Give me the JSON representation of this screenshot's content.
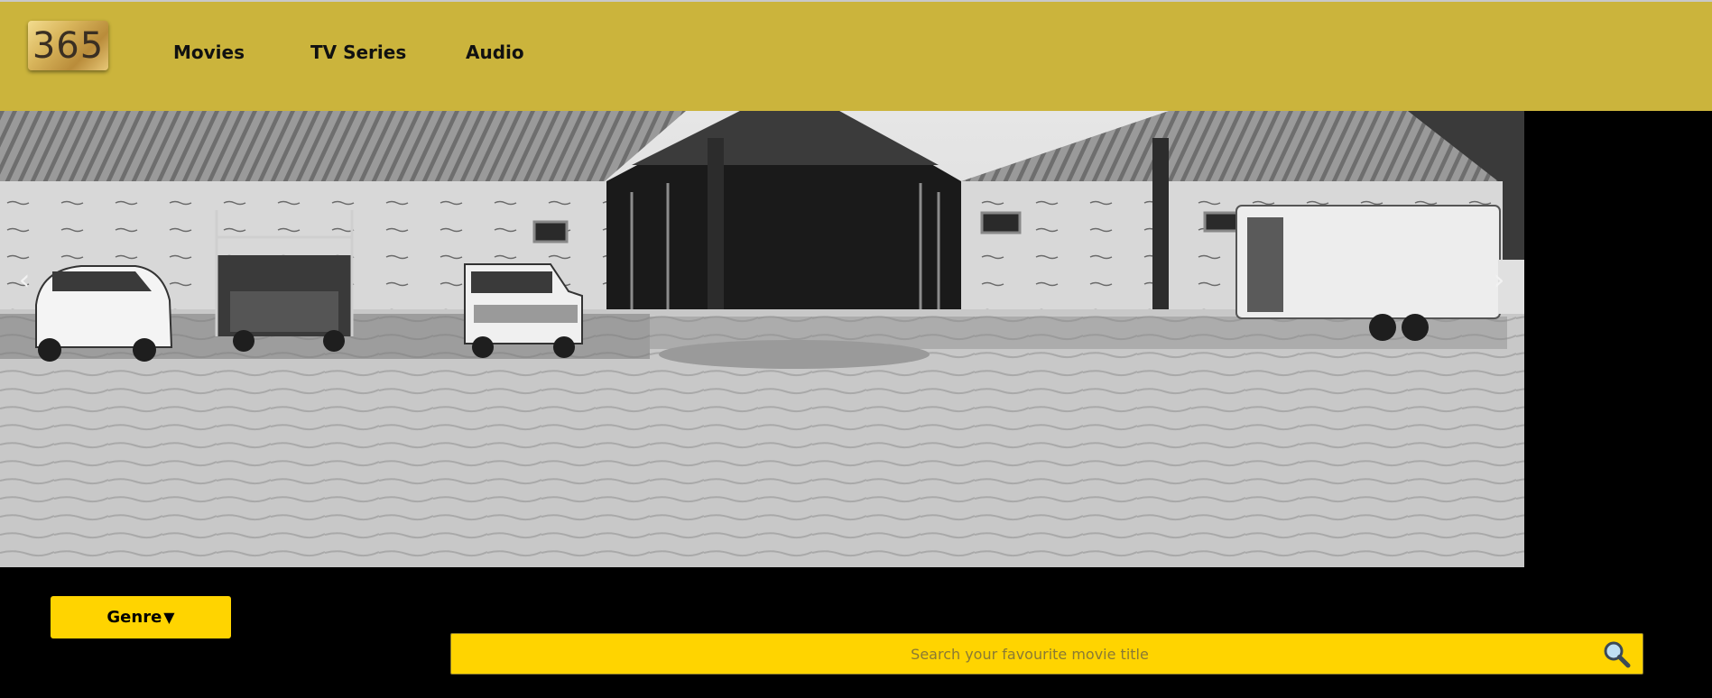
{
  "header": {
    "logo_text": "365",
    "nav": {
      "movies": "Movies",
      "tv_series": "TV Series",
      "audio": "Audio"
    },
    "background_color": "#cbb43c"
  },
  "carousel": {
    "prev_arrow": "‹",
    "next_arrow": "›"
  },
  "filters": {
    "genre_label": "Genre",
    "genre_caret": "▼"
  },
  "search": {
    "placeholder": "Search your favourite movie title",
    "icon": "magnifier-icon"
  },
  "colors": {
    "accent": "#ffd400",
    "page_background": "#000000"
  }
}
